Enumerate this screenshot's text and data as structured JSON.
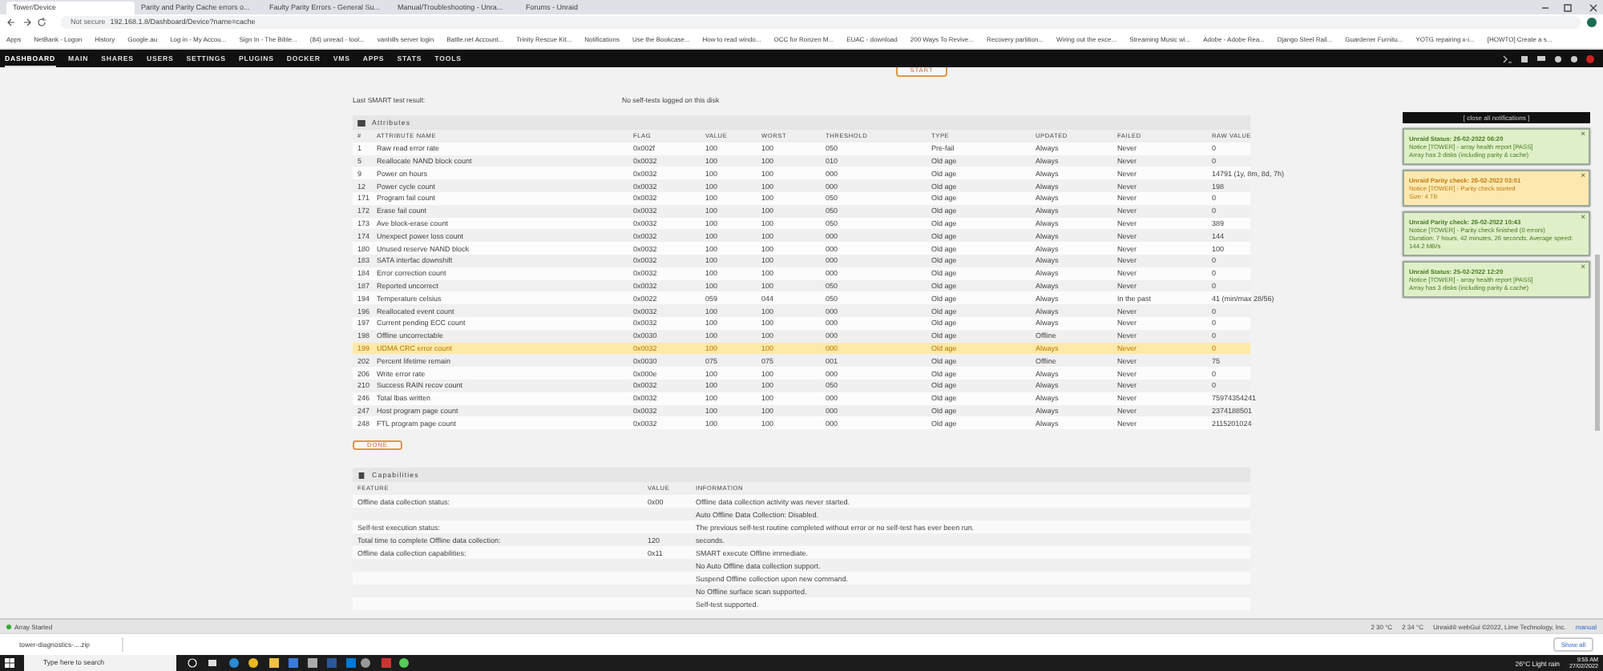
{
  "browser": {
    "tabs": [
      {
        "label": "Tower/Device",
        "selected": true
      },
      {
        "label": "Parity and Parity Cache errors o...",
        "selected": false
      },
      {
        "label": "Faulty Parity Errors - General Su...",
        "selected": false
      },
      {
        "label": "Manual/Troubleshooting - Unra...",
        "selected": false
      },
      {
        "label": "Forums - Unraid",
        "selected": false
      }
    ],
    "security": "Not secure",
    "url": "192.168.1.8/Dashboard/Device?name=cache",
    "bookmarks": [
      "Apps",
      "NetBank - Logon",
      "History",
      "Google.au",
      "Log in - My Accou...",
      "Sign In - The Bible...",
      "(84) unread - tool...",
      "vanhills server login",
      "Battle.net Account...",
      "Trinity Rescue Kit...",
      "Notifications",
      "Use the Bookcase...",
      "How to read windo...",
      "OCC for Ronzen M...",
      "EUAC - download",
      "200 Ways To Revive...",
      "Recovery partition...",
      "Wiring out the exce...",
      "Streaming Music wi...",
      "Adobe - Adobe Rea...",
      "Django Steel Rail...",
      "Guardener Furnitu...",
      "YOTG repairing x-i...",
      "[HOWTO] Create a s..."
    ]
  },
  "nav": [
    {
      "label": "DASHBOARD",
      "selected": true
    },
    {
      "label": "MAIN",
      "selected": false
    },
    {
      "label": "SHARES",
      "selected": false
    },
    {
      "label": "USERS",
      "selected": false
    },
    {
      "label": "SETTINGS",
      "selected": false
    },
    {
      "label": "PLUGINS",
      "selected": false
    },
    {
      "label": "DOCKER",
      "selected": false
    },
    {
      "label": "VMS",
      "selected": false
    },
    {
      "label": "APPS",
      "selected": false
    },
    {
      "label": "STATS",
      "selected": false
    },
    {
      "label": "TOOLS",
      "selected": false
    }
  ],
  "start_button": "START",
  "last_test": {
    "label": "Last SMART test result:",
    "value": "No self-tests logged on this disk"
  },
  "attributes": {
    "title": "Attributes",
    "columns": [
      "#",
      "ATTRIBUTE NAME",
      "FLAG",
      "VALUE",
      "WORST",
      "THRESHOLD",
      "TYPE",
      "UPDATED",
      "FAILED",
      "RAW VALUE"
    ],
    "rows": [
      {
        "highlighted": false,
        "cells": [
          "1",
          "Raw read error rate",
          "0x002f",
          "100",
          "100",
          "050",
          "Pre-fail",
          "Always",
          "Never",
          "0"
        ]
      },
      {
        "highlighted": false,
        "cells": [
          "5",
          "Reallocate NAND block count",
          "0x0032",
          "100",
          "100",
          "010",
          "Old age",
          "Always",
          "Never",
          "0"
        ]
      },
      {
        "highlighted": false,
        "cells": [
          "9",
          "Power on hours",
          "0x0032",
          "100",
          "100",
          "000",
          "Old age",
          "Always",
          "Never",
          "14791 (1y, 8m, 8d, 7h)"
        ]
      },
      {
        "highlighted": false,
        "cells": [
          "12",
          "Power cycle count",
          "0x0032",
          "100",
          "100",
          "000",
          "Old age",
          "Always",
          "Never",
          "198"
        ]
      },
      {
        "highlighted": false,
        "cells": [
          "171",
          "Program fail count",
          "0x0032",
          "100",
          "100",
          "050",
          "Old age",
          "Always",
          "Never",
          "0"
        ]
      },
      {
        "highlighted": false,
        "cells": [
          "172",
          "Erase fail count",
          "0x0032",
          "100",
          "100",
          "050",
          "Old age",
          "Always",
          "Never",
          "0"
        ]
      },
      {
        "highlighted": false,
        "cells": [
          "173",
          "Ave block-erase count",
          "0x0032",
          "100",
          "100",
          "050",
          "Old age",
          "Always",
          "Never",
          "389"
        ]
      },
      {
        "highlighted": false,
        "cells": [
          "174",
          "Unexpect power loss count",
          "0x0032",
          "100",
          "100",
          "000",
          "Old age",
          "Always",
          "Never",
          "144"
        ]
      },
      {
        "highlighted": false,
        "cells": [
          "180",
          "Unused reserve NAND block",
          "0x0032",
          "100",
          "100",
          "000",
          "Old age",
          "Always",
          "Never",
          "100"
        ]
      },
      {
        "highlighted": false,
        "cells": [
          "183",
          "SATA interfac downshift",
          "0x0032",
          "100",
          "100",
          "000",
          "Old age",
          "Always",
          "Never",
          "0"
        ]
      },
      {
        "highlighted": false,
        "cells": [
          "184",
          "Error correction count",
          "0x0032",
          "100",
          "100",
          "000",
          "Old age",
          "Always",
          "Never",
          "0"
        ]
      },
      {
        "highlighted": false,
        "cells": [
          "187",
          "Reported uncorrect",
          "0x0032",
          "100",
          "100",
          "050",
          "Old age",
          "Always",
          "Never",
          "0"
        ]
      },
      {
        "highlighted": false,
        "cells": [
          "194",
          "Temperature celsius",
          "0x0022",
          "059",
          "044",
          "050",
          "Old age",
          "Always",
          "In the past",
          "41 (min/max 28/56)"
        ]
      },
      {
        "highlighted": false,
        "cells": [
          "196",
          "Reallocated event count",
          "0x0032",
          "100",
          "100",
          "000",
          "Old age",
          "Always",
          "Never",
          "0"
        ]
      },
      {
        "highlighted": false,
        "cells": [
          "197",
          "Current pending ECC count",
          "0x0032",
          "100",
          "100",
          "000",
          "Old age",
          "Always",
          "Never",
          "0"
        ]
      },
      {
        "highlighted": false,
        "cells": [
          "198",
          "Offline uncorrectable",
          "0x0030",
          "100",
          "100",
          "000",
          "Old age",
          "Offline",
          "Never",
          "0"
        ]
      },
      {
        "highlighted": true,
        "cells": [
          "199",
          "UDMA CRC error count",
          "0x0032",
          "100",
          "100",
          "000",
          "Old age",
          "Always",
          "Never",
          "0"
        ]
      },
      {
        "highlighted": false,
        "cells": [
          "202",
          "Percent lifetime remain",
          "0x0030",
          "075",
          "075",
          "001",
          "Old age",
          "Offline",
          "Never",
          "75"
        ]
      },
      {
        "highlighted": false,
        "cells": [
          "206",
          "Write error rate",
          "0x000e",
          "100",
          "100",
          "000",
          "Old age",
          "Always",
          "Never",
          "0"
        ]
      },
      {
        "highlighted": false,
        "cells": [
          "210",
          "Success RAIN recov count",
          "0x0032",
          "100",
          "100",
          "050",
          "Old age",
          "Always",
          "Never",
          "0"
        ]
      },
      {
        "highlighted": false,
        "cells": [
          "246",
          "Total lbas written",
          "0x0032",
          "100",
          "100",
          "000",
          "Old age",
          "Always",
          "Never",
          "75974354241"
        ]
      },
      {
        "highlighted": false,
        "cells": [
          "247",
          "Host program page count",
          "0x0032",
          "100",
          "100",
          "000",
          "Old age",
          "Always",
          "Never",
          "2374188501"
        ]
      },
      {
        "highlighted": false,
        "cells": [
          "248",
          "FTL program page count",
          "0x0032",
          "100",
          "100",
          "000",
          "Old age",
          "Always",
          "Never",
          "2115201024"
        ]
      }
    ]
  },
  "done_button": "DONE",
  "capabilities": {
    "title": "Capabilities",
    "columns": [
      "FEATURE",
      "VALUE",
      "INFORMATION"
    ],
    "rows": [
      [
        "Offline data collection status:",
        "0x00",
        "Offline data collection activity was never started."
      ],
      [
        "",
        "",
        "Auto Offline Data Collection: Disabled."
      ],
      [
        "Self-test execution status:",
        "",
        "The previous self-test routine completed without error or no self-test has ever been run."
      ],
      [
        "Total time to complete Offline data collection:",
        "120",
        "seconds."
      ],
      [
        "Offline data collection capabilities:",
        "0x11",
        "SMART execute Offline immediate."
      ],
      [
        "",
        "",
        "No Auto Offline data collection support."
      ],
      [
        "",
        "",
        "Suspend Offline collection upon new command."
      ],
      [
        "",
        "",
        "No Offline surface scan supported."
      ],
      [
        "",
        "",
        "Self-test supported."
      ]
    ]
  },
  "notifications": {
    "close_all": "[ close all notifications ]",
    "close": "×",
    "items": [
      {
        "kind": "normal",
        "title": "Unraid Status: 26-02-2022 06:20",
        "lines": [
          "Notice [TOWER] - array health report [PASS]",
          "Array has 3 disks (including parity & cache)"
        ]
      },
      {
        "kind": "warning",
        "title": "Unraid Parity check: 26-02-2022 03:01",
        "lines": [
          "Notice [TOWER] - Parity check started",
          "Size: 4 TB"
        ]
      },
      {
        "kind": "normal",
        "title": "Unraid Parity check: 26-02-2022 10:43",
        "lines": [
          "Notice [TOWER] - Parity check finished (0 errors)",
          "Duration: 7 hours, 42 minutes, 26 seconds. Average speed: 144.2 MB/s"
        ]
      },
      {
        "kind": "normal",
        "title": "Unraid Status: 25-02-2022 12:20",
        "lines": [
          "Notice [TOWER] - array health report [PASS]",
          "Array has 3 disks (including parity & cache)"
        ]
      }
    ]
  },
  "status_bar": {
    "array": "Array Started",
    "temps": [
      "2 30 °C",
      "2 34 °C"
    ],
    "copyright": "Unraid® webGui ©2022, Lime Technology, Inc.",
    "manual": "manual"
  },
  "download": {
    "file": "tower-diagnostics-....zip",
    "show_all": "Show all"
  },
  "taskbar": {
    "search_placeholder": "Type here to search",
    "weather": "26°C Light rain",
    "time": "9:55 AM",
    "date": "27/02/2022"
  }
}
